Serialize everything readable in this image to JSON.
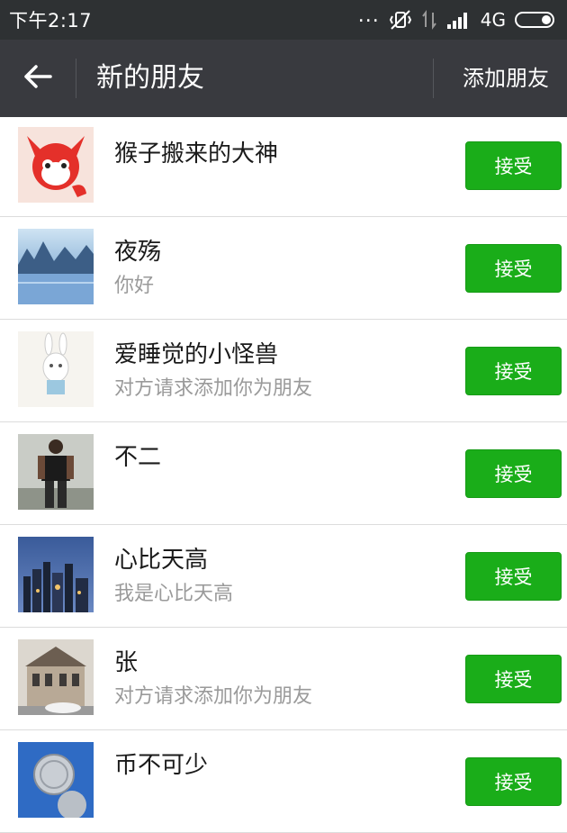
{
  "status_bar": {
    "time": "下午2:17",
    "overflow": "...",
    "network": "4G"
  },
  "header": {
    "title": "新的朋友",
    "action": "添加朋友"
  },
  "requests": [
    {
      "name": "猴子搬来的大神",
      "message": "",
      "accept": "接受"
    },
    {
      "name": "夜殇",
      "message": "你好",
      "accept": "接受"
    },
    {
      "name": "爱睡觉的小怪兽",
      "message": "对方请求添加你为朋友",
      "accept": "接受"
    },
    {
      "name": "不二",
      "message": "",
      "accept": "接受"
    },
    {
      "name": "心比天高",
      "message": "我是心比天高",
      "accept": "接受"
    },
    {
      "name": "张",
      "message": "对方请求添加你为朋友",
      "accept": "接受"
    },
    {
      "name": "币不可少",
      "message": "",
      "accept": "接受"
    }
  ],
  "colors": {
    "header_bg": "#393a3f",
    "status_bg": "#2e3133",
    "accent_green": "#1aad19"
  }
}
